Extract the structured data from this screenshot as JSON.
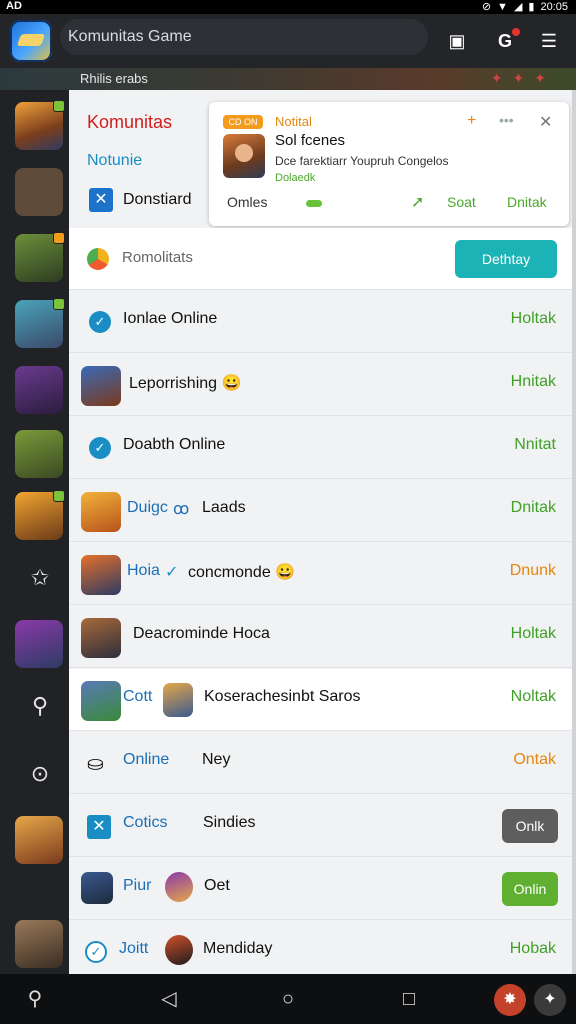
{
  "status": {
    "left": "AD",
    "time": "20:05"
  },
  "appbar": {
    "title": "Komunitas Game"
  },
  "banner": {
    "text": "Rhilis erabs"
  },
  "menu": {
    "title": "Komunitas",
    "subtitle": "Notunie",
    "item": "Donstiard"
  },
  "notification": {
    "tag": "CD ON",
    "kind": "Notital",
    "title": "Sol fcenes",
    "body": "Dce farektiarr Youpruh Congelos",
    "status": "Dolaedk",
    "foot_left": "Omles",
    "foot_mid": "Soat",
    "foot_right": "Dnitak"
  },
  "search": {
    "text": "Romolitats",
    "button": "Dethtay"
  },
  "rows": [
    {
      "label": "Ionlae Online",
      "action": "Holtak"
    },
    {
      "label": "Leporrishing 😀",
      "action": "Hnitak"
    },
    {
      "label": "Doabth Online",
      "action": "Nnitat"
    },
    {
      "prefix": "Duigc",
      "label": "Laads",
      "action": "Dnitak"
    },
    {
      "prefix": "Hoia",
      "label": "concmonde 😀",
      "action": "Dnunk"
    },
    {
      "label": "Deacrominde Hoca",
      "action": "Holtak"
    },
    {
      "prefix": "Cott",
      "label": "Koserachesinbt Saros",
      "action": "Noltak"
    },
    {
      "prefix": "Online",
      "label": "Ney",
      "action": "Ontak"
    },
    {
      "prefix": "Cotics",
      "label": "Sindies",
      "action": "Onlk"
    },
    {
      "prefix": "Piur",
      "label": "Oet",
      "action": "Onlin"
    },
    {
      "prefix": "Joitt",
      "label": "Mendiday",
      "action": "Hobak"
    }
  ],
  "icons": {
    "menu": "hamburger-icon",
    "quick": "square-icon",
    "google": "g-icon"
  }
}
